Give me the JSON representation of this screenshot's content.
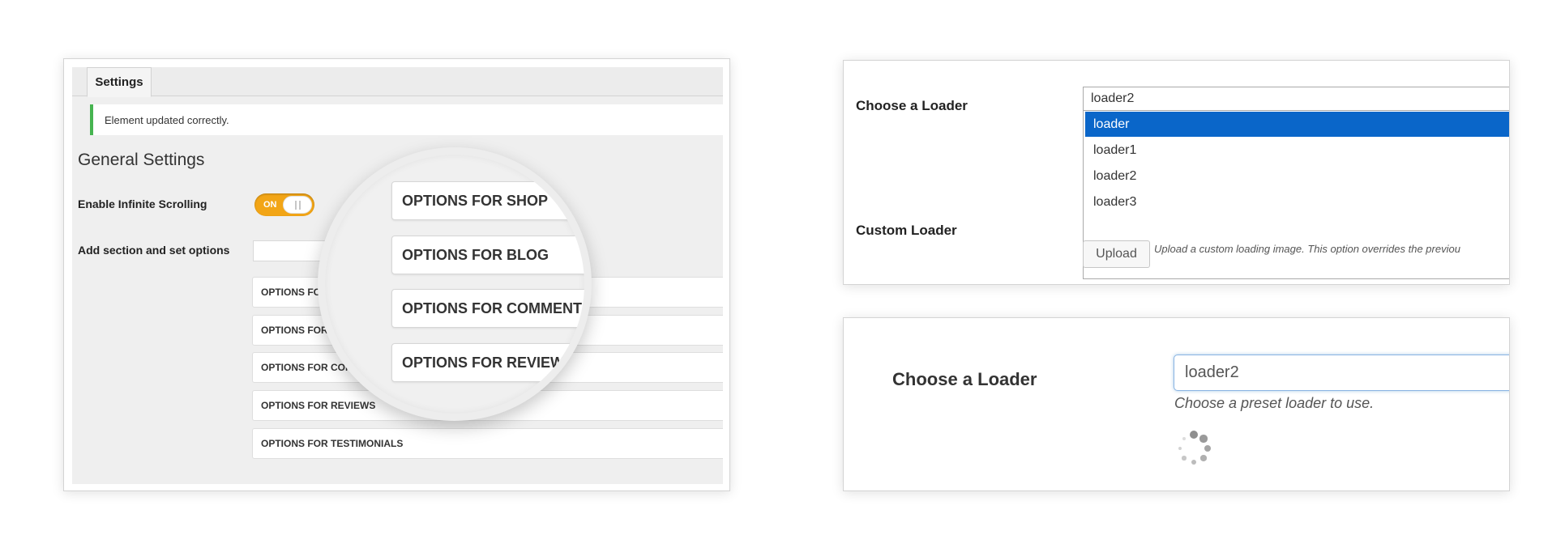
{
  "left_panel": {
    "tab_label": "Settings",
    "notice": "Element updated correctly.",
    "section_title": "General Settings",
    "infinite_scrolling": {
      "label": "Enable Infinite Scrolling",
      "toggle_text": "ON",
      "value": true
    },
    "add_section_label": "Add section and set options",
    "option_rows": [
      "OPTIONS FOR SHOP",
      "OPTIONS FOR BLOG",
      "OPTIONS FOR COMMENTS",
      "OPTIONS FOR REVIEWS",
      "OPTIONS FOR TESTIMONIALS"
    ],
    "magnifier_rows": [
      "OPTIONS FOR SHOP",
      "OPTIONS FOR BLOG",
      "OPTIONS FOR COMMENTS",
      "OPTIONS FOR REVIEWS"
    ],
    "colors": {
      "toggle_on": "#f2a516",
      "notice_border": "#46b450"
    }
  },
  "right_top_panel": {
    "choose_label": "Choose a Loader",
    "selected_value": "loader2",
    "options": [
      "loader",
      "loader1",
      "loader2",
      "loader3"
    ],
    "highlighted_option": "loader",
    "custom_label": "Custom Loader",
    "upload_button": "Upload",
    "upload_description": "Upload a custom loading image. This option overrides the previou",
    "colors": {
      "highlight": "#0a66c9"
    }
  },
  "right_bottom_panel": {
    "choose_label": "Choose a Loader",
    "selected_value": "loader2",
    "help_text": "Choose a preset loader to use.",
    "spinner_icon": "loading-spinner-icon"
  }
}
